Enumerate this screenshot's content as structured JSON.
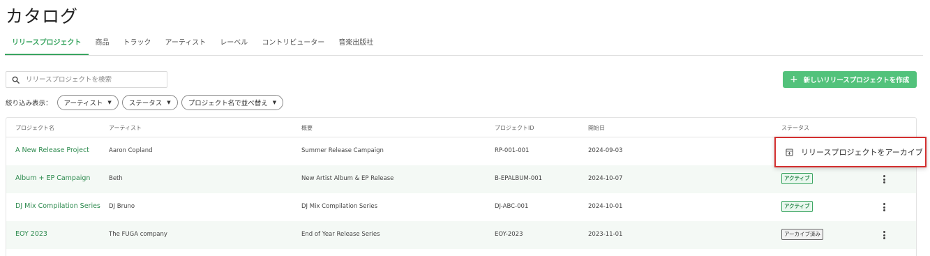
{
  "page": {
    "title": "カタログ"
  },
  "tabs": [
    {
      "label": "リリースプロジェクト",
      "active": true
    },
    {
      "label": "商品",
      "active": false
    },
    {
      "label": "トラック",
      "active": false
    },
    {
      "label": "アーティスト",
      "active": false
    },
    {
      "label": "レーベル",
      "active": false
    },
    {
      "label": "コントリビューター",
      "active": false
    },
    {
      "label": "音楽出版社",
      "active": false
    }
  ],
  "search": {
    "placeholder": "リリースプロジェクトを検索",
    "value": "",
    "icon": "search-icon"
  },
  "new_button": {
    "label": "新しいリリースプロジェクトを作成",
    "icon": "plus-icon",
    "color": "#52c27b"
  },
  "filters": {
    "label": "絞り込み表示：",
    "chips": [
      {
        "label": "アーティスト"
      },
      {
        "label": "ステータス"
      },
      {
        "label": "プロジェクト名で並べ替え"
      }
    ]
  },
  "table": {
    "headers": [
      "プロジェクト名",
      "アーティスト",
      "概要",
      "プロジェクトID",
      "開始日",
      "ステータス"
    ],
    "rows": [
      {
        "name": "A New Release Project",
        "artist": "Aaron Copland",
        "summary": "Summer Release Campaign",
        "id": "RP-001-001",
        "date": "2024-09-03",
        "status": ""
      },
      {
        "name": "Album + EP Campaign",
        "artist": "Beth",
        "summary": "New Artist Album & EP Release",
        "id": "B-EPALBUM-001",
        "date": "2024-10-07",
        "status": "アクティブ"
      },
      {
        "name": "DJ Mix Compilation Series",
        "artist": "DJ Bruno",
        "summary": "DJ Mix Compilation Series",
        "id": "DJ-ABC-001",
        "date": "2024-10-01",
        "status": "アクティブ"
      },
      {
        "name": "EOY 2023",
        "artist": "The FUGA company",
        "summary": "End of Year Release Series",
        "id": "EOY-2023",
        "date": "2023-11-01",
        "status": "アーカイブ済み"
      }
    ]
  },
  "context_menu": {
    "label": "リリースプロジェクトをアーカイブ",
    "icon": "archive-icon",
    "highlight_color": "#d32f2f"
  },
  "colors": {
    "accent": "#3aa561",
    "active_status": "#2d8a4e"
  }
}
